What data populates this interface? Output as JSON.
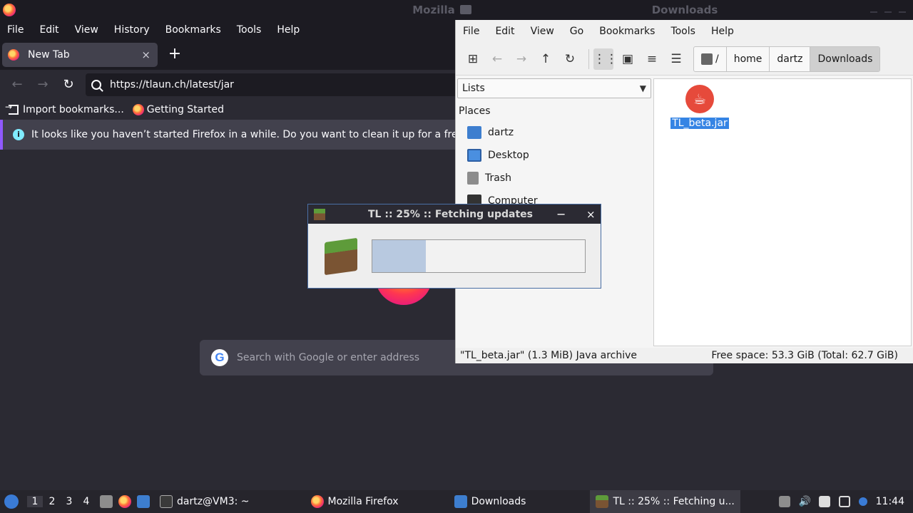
{
  "firefox": {
    "window_title": "Mozilla",
    "menu": [
      "File",
      "Edit",
      "View",
      "History",
      "Bookmarks",
      "Tools",
      "Help"
    ],
    "tab": {
      "label": "New Tab",
      "close": "×"
    },
    "new_tab_button": "+",
    "nav": {
      "back": "←",
      "forward": "→",
      "reload": "↻"
    },
    "url": "https://tlaun.ch/latest/jar",
    "bookmarks": [
      "Import bookmarks...",
      "Getting Started"
    ],
    "notice": {
      "icon": "i",
      "text": "It looks like you haven’t started Firefox in a while. Do you want to clean it up for a fresh, like-new experience?"
    },
    "search_placeholder": "Search with Google or enter address",
    "google_glyph": "G"
  },
  "file_manager": {
    "window_title": "Downloads",
    "menu": [
      "File",
      "Edit",
      "View",
      "Go",
      "Bookmarks",
      "Tools",
      "Help"
    ],
    "toolbar": [
      "⊞",
      "←",
      "→",
      "↑",
      "↻",
      "⋮⋮",
      "▣",
      "≡",
      "☰"
    ],
    "breadcrumb": [
      "/",
      "home",
      "dartz",
      "Downloads"
    ],
    "sidebar_mode": "Lists",
    "places_header": "Places",
    "places": [
      "dartz",
      "Desktop",
      "Trash",
      "Computer"
    ],
    "files": [
      {
        "name": "TL_beta.jar",
        "icon": "java-icon"
      }
    ],
    "status_left": "\"TL_beta.jar\" (1.3 MiB) Java archive",
    "status_right": "Free space: 53.3 GiB (Total: 62.7 GiB)"
  },
  "tl_dialog": {
    "title": "TL :: 25% :: Fetching updates",
    "minimize": "−",
    "close": "×",
    "progress": 0.25
  },
  "taskbar": {
    "workspaces": [
      "1",
      "2",
      "3",
      "4"
    ],
    "tasks": [
      {
        "label": "dartz@VM3: ~",
        "icon": "terminal-icon"
      },
      {
        "label": "Mozilla Firefox",
        "icon": "firefox-icon"
      },
      {
        "label": "Downloads",
        "icon": "folder-icon"
      },
      {
        "label": "TL :: 25% :: Fetching u...",
        "icon": "minecraft-icon"
      }
    ],
    "clock": "11:44"
  }
}
